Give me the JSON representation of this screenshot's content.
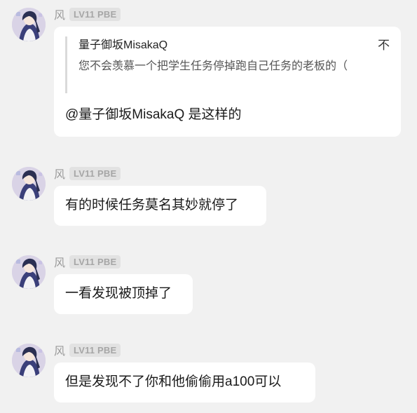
{
  "messages": [
    {
      "sender": "风",
      "badge": "LV11 PBE",
      "quote": {
        "author": "量子御坂MisakaQ",
        "extra": "不",
        "text": "您不会羡慕一个把学生任务停掉跑自己任务的老板的（"
      },
      "text": "@量子御坂MisakaQ 是这样的"
    },
    {
      "sender": "风",
      "badge": "LV11 PBE",
      "text": "有的时候任务莫名其妙就停了"
    },
    {
      "sender": "风",
      "badge": "LV11 PBE",
      "text": "一看发现被顶掉了"
    },
    {
      "sender": "风",
      "badge": "LV11 PBE",
      "text": "但是发现不了你和他偷偷用a100可以"
    }
  ],
  "colors": {
    "background": "#f1f1f1",
    "bubble": "#ffffff",
    "badge_bg": "#e2e2e2",
    "badge_text": "#a6a6a6"
  },
  "icons": {
    "avatar": "anime-character-avatar"
  }
}
